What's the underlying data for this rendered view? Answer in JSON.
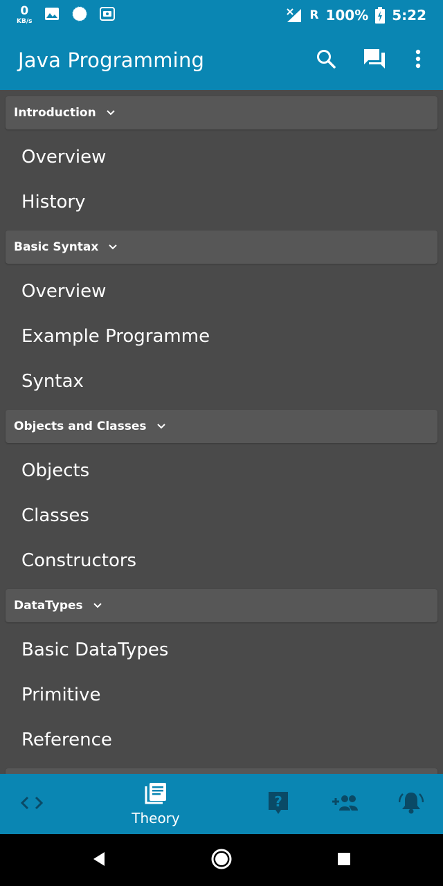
{
  "status_bar": {
    "speed_value": "0",
    "speed_unit": "KB/s",
    "roaming": "R",
    "battery": "100%",
    "time": "5:22"
  },
  "app_bar": {
    "title": "Java Programming",
    "actions": [
      "search-icon",
      "forum-icon",
      "more-vert-icon"
    ]
  },
  "sections": [
    {
      "title": "Introduction",
      "items": [
        "Overview",
        "History"
      ]
    },
    {
      "title": "Basic Syntax",
      "items": [
        "Overview",
        "Example Programme",
        "Syntax"
      ]
    },
    {
      "title": "Objects and Classes",
      "items": [
        "Objects",
        "Classes",
        "Constructors"
      ]
    },
    {
      "title": "DataTypes",
      "items": [
        "Basic DataTypes",
        "Primitive",
        "Reference"
      ]
    }
  ],
  "bottom_nav": {
    "theory_label": "Theory",
    "active": "theory",
    "icons": [
      "code-icon",
      "article-icon",
      "help-icon",
      "group-add-icon",
      "notification-icon"
    ]
  },
  "colors": {
    "primary": "#0a86b3",
    "background": "#4a4a4a",
    "section_header": "#575757",
    "inactive_icon": "#0a4a66"
  }
}
